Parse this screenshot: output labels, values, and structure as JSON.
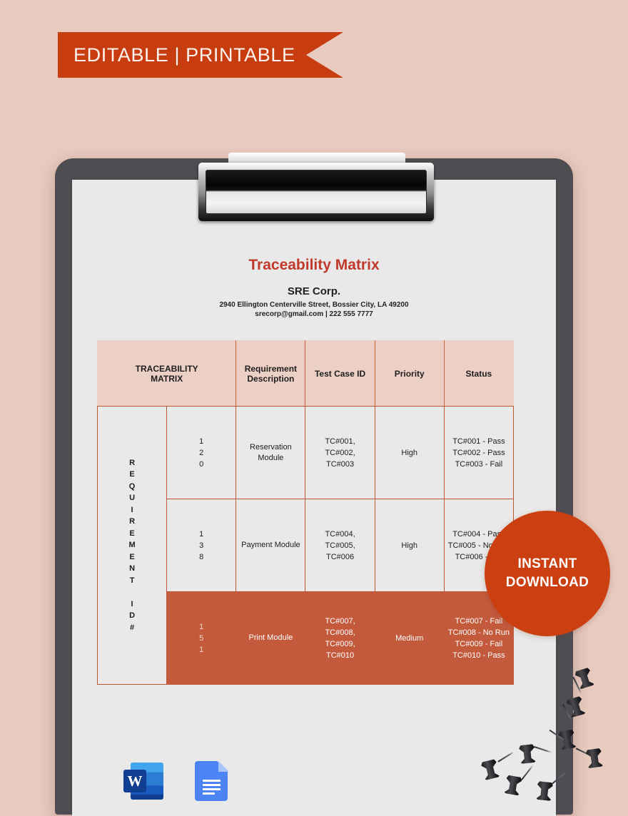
{
  "banner": {
    "text": "EDITABLE | PRINTABLE",
    "color": "#c83d10"
  },
  "badge": {
    "line1": "INSTANT",
    "line2": "DOWNLOAD",
    "color": "#cb3f11"
  },
  "document": {
    "title": "Traceability Matrix",
    "title_color": "#c0392b",
    "company_name": "SRE Corp.",
    "address": "2940 Ellington Centerville Street, Bossier City, LA 49200",
    "contact": "srecorp@gmail.com | 222 555 7777"
  },
  "table": {
    "headers": [
      "TRACEABILITY MATRIX",
      "Requirement Description",
      "Test Case ID",
      "Priority",
      "Status"
    ],
    "header_line1": "TRACEABILITY",
    "header_line2": "MATRIX",
    "header_bg": "#edd0c5",
    "border_color": "#c0562f",
    "highlight_bg": "#c45a3c",
    "row_bg": "#e9e9e9",
    "vertical_label": "REQUIREMENT ID #",
    "vertical_label_lines": [
      "R",
      "E",
      "Q",
      "U",
      "I",
      "R",
      "E",
      "M",
      "E",
      "N",
      "T",
      "",
      "I",
      "D",
      "#"
    ],
    "rows": [
      {
        "id": "120",
        "id_digits": [
          "1",
          "2",
          "0"
        ],
        "description": "Reservation Module",
        "test_case_ids": [
          "TC#001,",
          "TC#002,",
          "TC#003"
        ],
        "priority": "High",
        "status": [
          "TC#001 - Pass",
          "TC#002 - Pass",
          "TC#003 - Fail"
        ],
        "highlight": false
      },
      {
        "id": "138",
        "id_digits": [
          "1",
          "3",
          "8"
        ],
        "description": "Payment Module",
        "test_case_ids": [
          "TC#004,",
          "TC#005,",
          "TC#006"
        ],
        "priority": "High",
        "status": [
          "TC#004 - Pass",
          "TC#005 - No Run",
          "TC#006 - Fail"
        ],
        "highlight": false
      },
      {
        "id": "151",
        "id_digits": [
          "1",
          "5",
          "1"
        ],
        "description": "Print Module",
        "test_case_ids": [
          "TC#007,",
          "TC#008,",
          "TC#009,",
          "TC#010"
        ],
        "priority": "Medium",
        "status": [
          "TC#007 - Fail TC#008 - No Run",
          "TC#009 - Fail",
          "TC#010 - Pass"
        ],
        "highlight": true
      }
    ]
  },
  "formats": [
    {
      "name": "microsoft-word",
      "letter": "W"
    },
    {
      "name": "google-docs",
      "letter": ""
    }
  ]
}
